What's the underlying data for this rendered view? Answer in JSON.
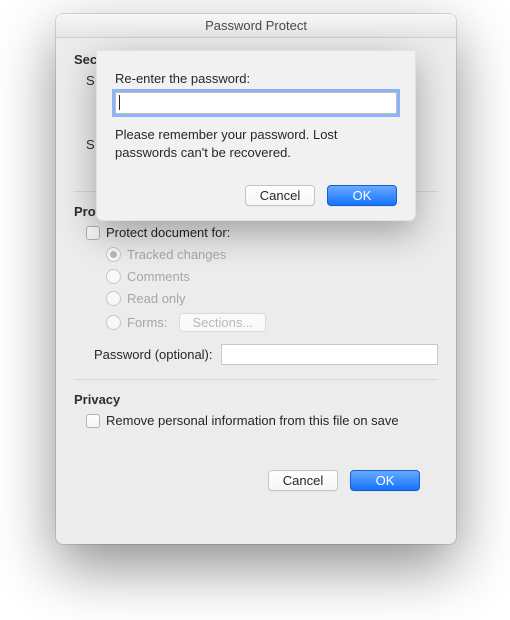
{
  "window": {
    "title": "Password Protect"
  },
  "security": {
    "header": "Security",
    "stub1": "S",
    "stub2": "S"
  },
  "protection": {
    "header": "Protection",
    "protect_label": "Protect document for:",
    "options": {
      "tracked": "Tracked changes",
      "comments": "Comments",
      "read_only": "Read only",
      "forms": "Forms:",
      "sections_btn": "Sections..."
    },
    "pw_label": "Password (optional):"
  },
  "privacy": {
    "header": "Privacy",
    "remove_label": "Remove personal information from this file on save"
  },
  "footer": {
    "cancel": "Cancel",
    "ok": "OK"
  },
  "sheet": {
    "prompt": "Re-enter the password:",
    "input_value": "",
    "hint": "Please remember your password. Lost passwords can't be recovered.",
    "cancel": "Cancel",
    "ok": "OK"
  }
}
